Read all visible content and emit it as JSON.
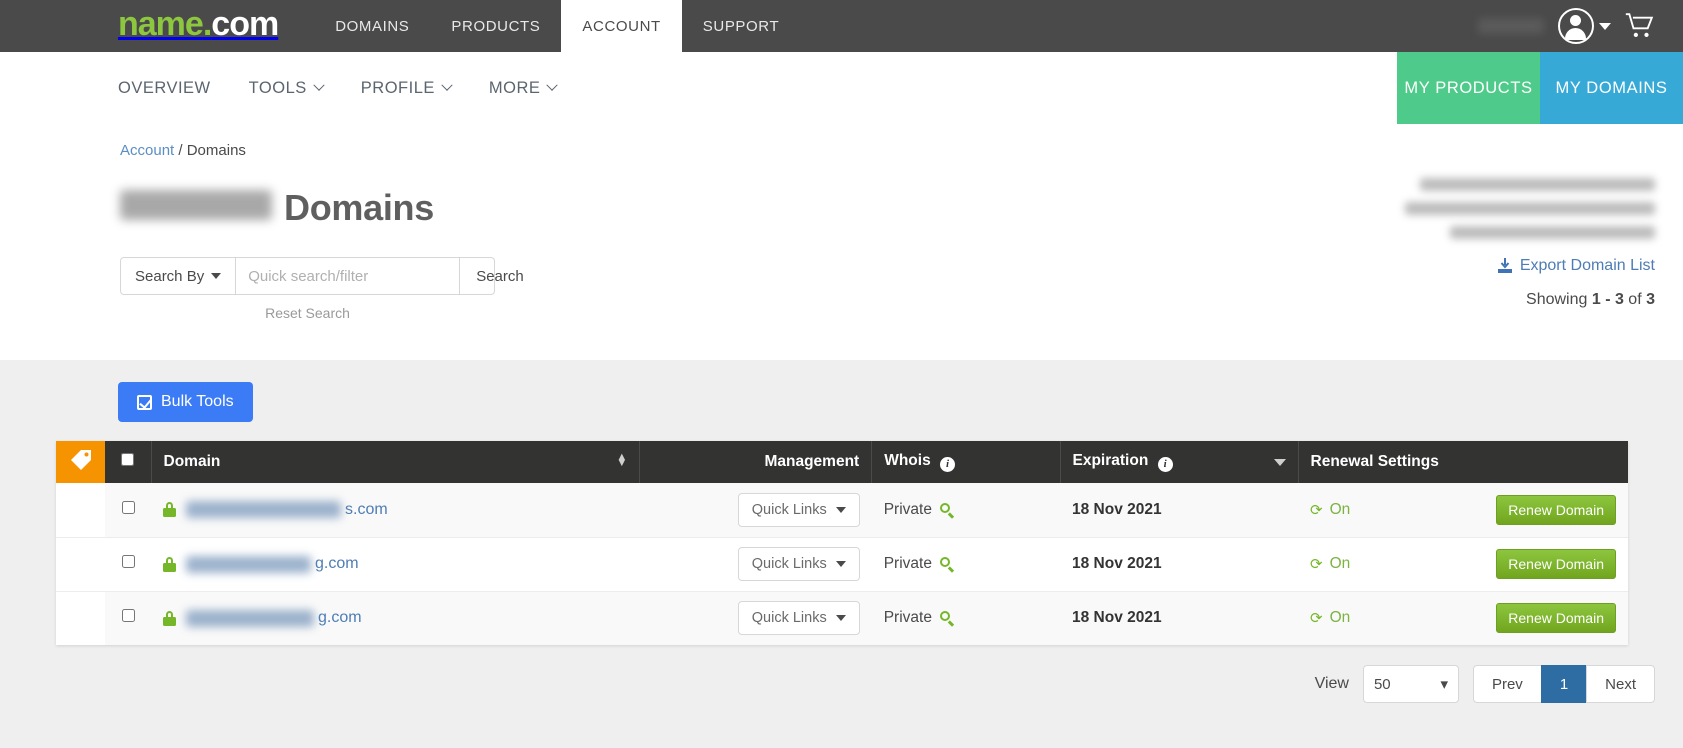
{
  "topnav": {
    "logo": {
      "name": "name",
      "dot": ".",
      "com": "com"
    },
    "items": [
      {
        "label": "DOMAINS",
        "active": false
      },
      {
        "label": "PRODUCTS",
        "active": false
      },
      {
        "label": "ACCOUNT",
        "active": true
      },
      {
        "label": "SUPPORT",
        "active": false
      }
    ],
    "account_icon": "user-avatar-icon",
    "cart_icon": "shopping-cart-icon"
  },
  "subnav": {
    "items": [
      {
        "label": "OVERVIEW",
        "has_caret": false
      },
      {
        "label": "TOOLS",
        "has_caret": true
      },
      {
        "label": "PROFILE",
        "has_caret": true
      },
      {
        "label": "MORE",
        "has_caret": true
      }
    ],
    "my_products": "MY PRODUCTS",
    "my_domains": "MY DOMAINS",
    "green": "#4ecb8a",
    "blue": "#36a9d6"
  },
  "breadcrumb": {
    "account": "Account",
    "sep": "/",
    "current": "Domains"
  },
  "page_title": {
    "suffix": "Domains"
  },
  "search": {
    "search_by_label": "Search By",
    "placeholder": "Quick search/filter",
    "search_button": "Search",
    "reset_link": "Reset Search"
  },
  "right_info": {
    "export_label": "Export Domain List",
    "export_icon": "download-icon",
    "showing_prefix": "Showing ",
    "showing_range": "1 - 3",
    "showing_mid": " of ",
    "showing_total": "3"
  },
  "bulk_tools": {
    "label": "Bulk Tools",
    "icon": "checked-box-icon",
    "color": "#3b7bf6"
  },
  "table": {
    "columns": {
      "tag": "tag-icon",
      "select_all": "select-all-checkbox",
      "domain": "Domain",
      "management": "Management",
      "whois": "Whois",
      "expiration": "Expiration",
      "renewal": "Renewal Settings"
    },
    "rows": [
      {
        "domain_tld": "s.com",
        "blur_width": 155,
        "quick_links": "Quick Links",
        "whois": "Private",
        "expiration": "18 Nov 2021",
        "auto_renew": "On",
        "renew_button": "Renew Domain"
      },
      {
        "domain_tld": "g.com",
        "blur_width": 125,
        "quick_links": "Quick Links",
        "whois": "Private",
        "expiration": "18 Nov 2021",
        "auto_renew": "On",
        "renew_button": "Renew Domain"
      },
      {
        "domain_tld": "g.com",
        "blur_width": 128,
        "quick_links": "Quick Links",
        "whois": "Private",
        "expiration": "18 Nov 2021",
        "auto_renew": "On",
        "renew_button": "Renew Domain"
      }
    ]
  },
  "pagination": {
    "view_label": "View",
    "per_page": "50",
    "prev": "Prev",
    "current_page": "1",
    "next": "Next"
  }
}
